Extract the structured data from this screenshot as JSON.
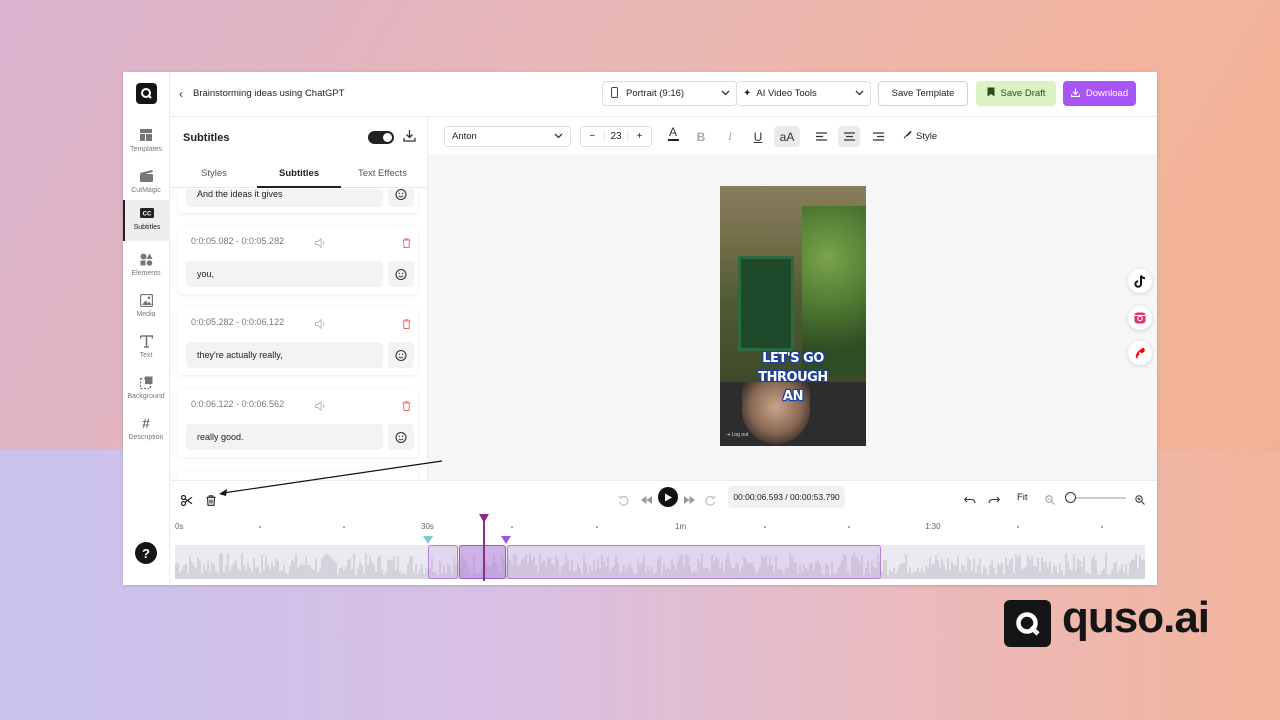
{
  "project": {
    "title": "Brainstorming ideas using ChatGPT"
  },
  "topbar": {
    "format_select": "Portrait (9:16)",
    "ai_tools_select": "AI Video Tools",
    "save_template": "Save Template",
    "save_draft": "Save Draft",
    "download": "Download"
  },
  "rail": {
    "items": [
      {
        "label": "Templates",
        "icon": "templates-icon"
      },
      {
        "label": "CutMagic",
        "icon": "clapper-icon"
      },
      {
        "label": "Subtitles",
        "icon": "cc-icon"
      },
      {
        "label": "Elements",
        "icon": "shapes-icon"
      },
      {
        "label": "Media",
        "icon": "image-icon"
      },
      {
        "label": "Text",
        "icon": "text-icon"
      },
      {
        "label": "Background",
        "icon": "background-icon"
      },
      {
        "label": "Description",
        "icon": "hash-icon"
      }
    ],
    "active": "Subtitles"
  },
  "panel": {
    "title": "Subtitles",
    "subtitles_enabled": true,
    "tabs": [
      "Styles",
      "Subtitles",
      "Text Effects"
    ],
    "active_tab": "Subtitles",
    "segments": [
      {
        "time": "",
        "text": "And the ideas it gives"
      },
      {
        "time": "0:0:05.082 - 0:0:05.282",
        "text": "you,"
      },
      {
        "time": "0:0:05.282 - 0:0:06.122",
        "text": "they're actually really,"
      },
      {
        "time": "0:0:06.122  - 0:0:06.562",
        "text": "really good."
      }
    ]
  },
  "toolbar": {
    "font": "Anton",
    "font_size": "23",
    "decrease": "−",
    "increase": "+",
    "style_label": "Style",
    "alignment": "center"
  },
  "preview": {
    "caption_line1": "LET'S GO THROUGH",
    "caption_line2": "AN",
    "logout": "Log out"
  },
  "timeline": {
    "time_display": "00:00:06.593 / 00:00:53.790",
    "fit_label": "Fit",
    "ruler": [
      "0s",
      "30s",
      "1m",
      "1:30"
    ]
  },
  "brand": {
    "name": "quso.ai"
  },
  "colors": {
    "accent_purple": "#a855f7",
    "draft_green": "#d9f3c3",
    "playhead": "#8a2f86"
  }
}
